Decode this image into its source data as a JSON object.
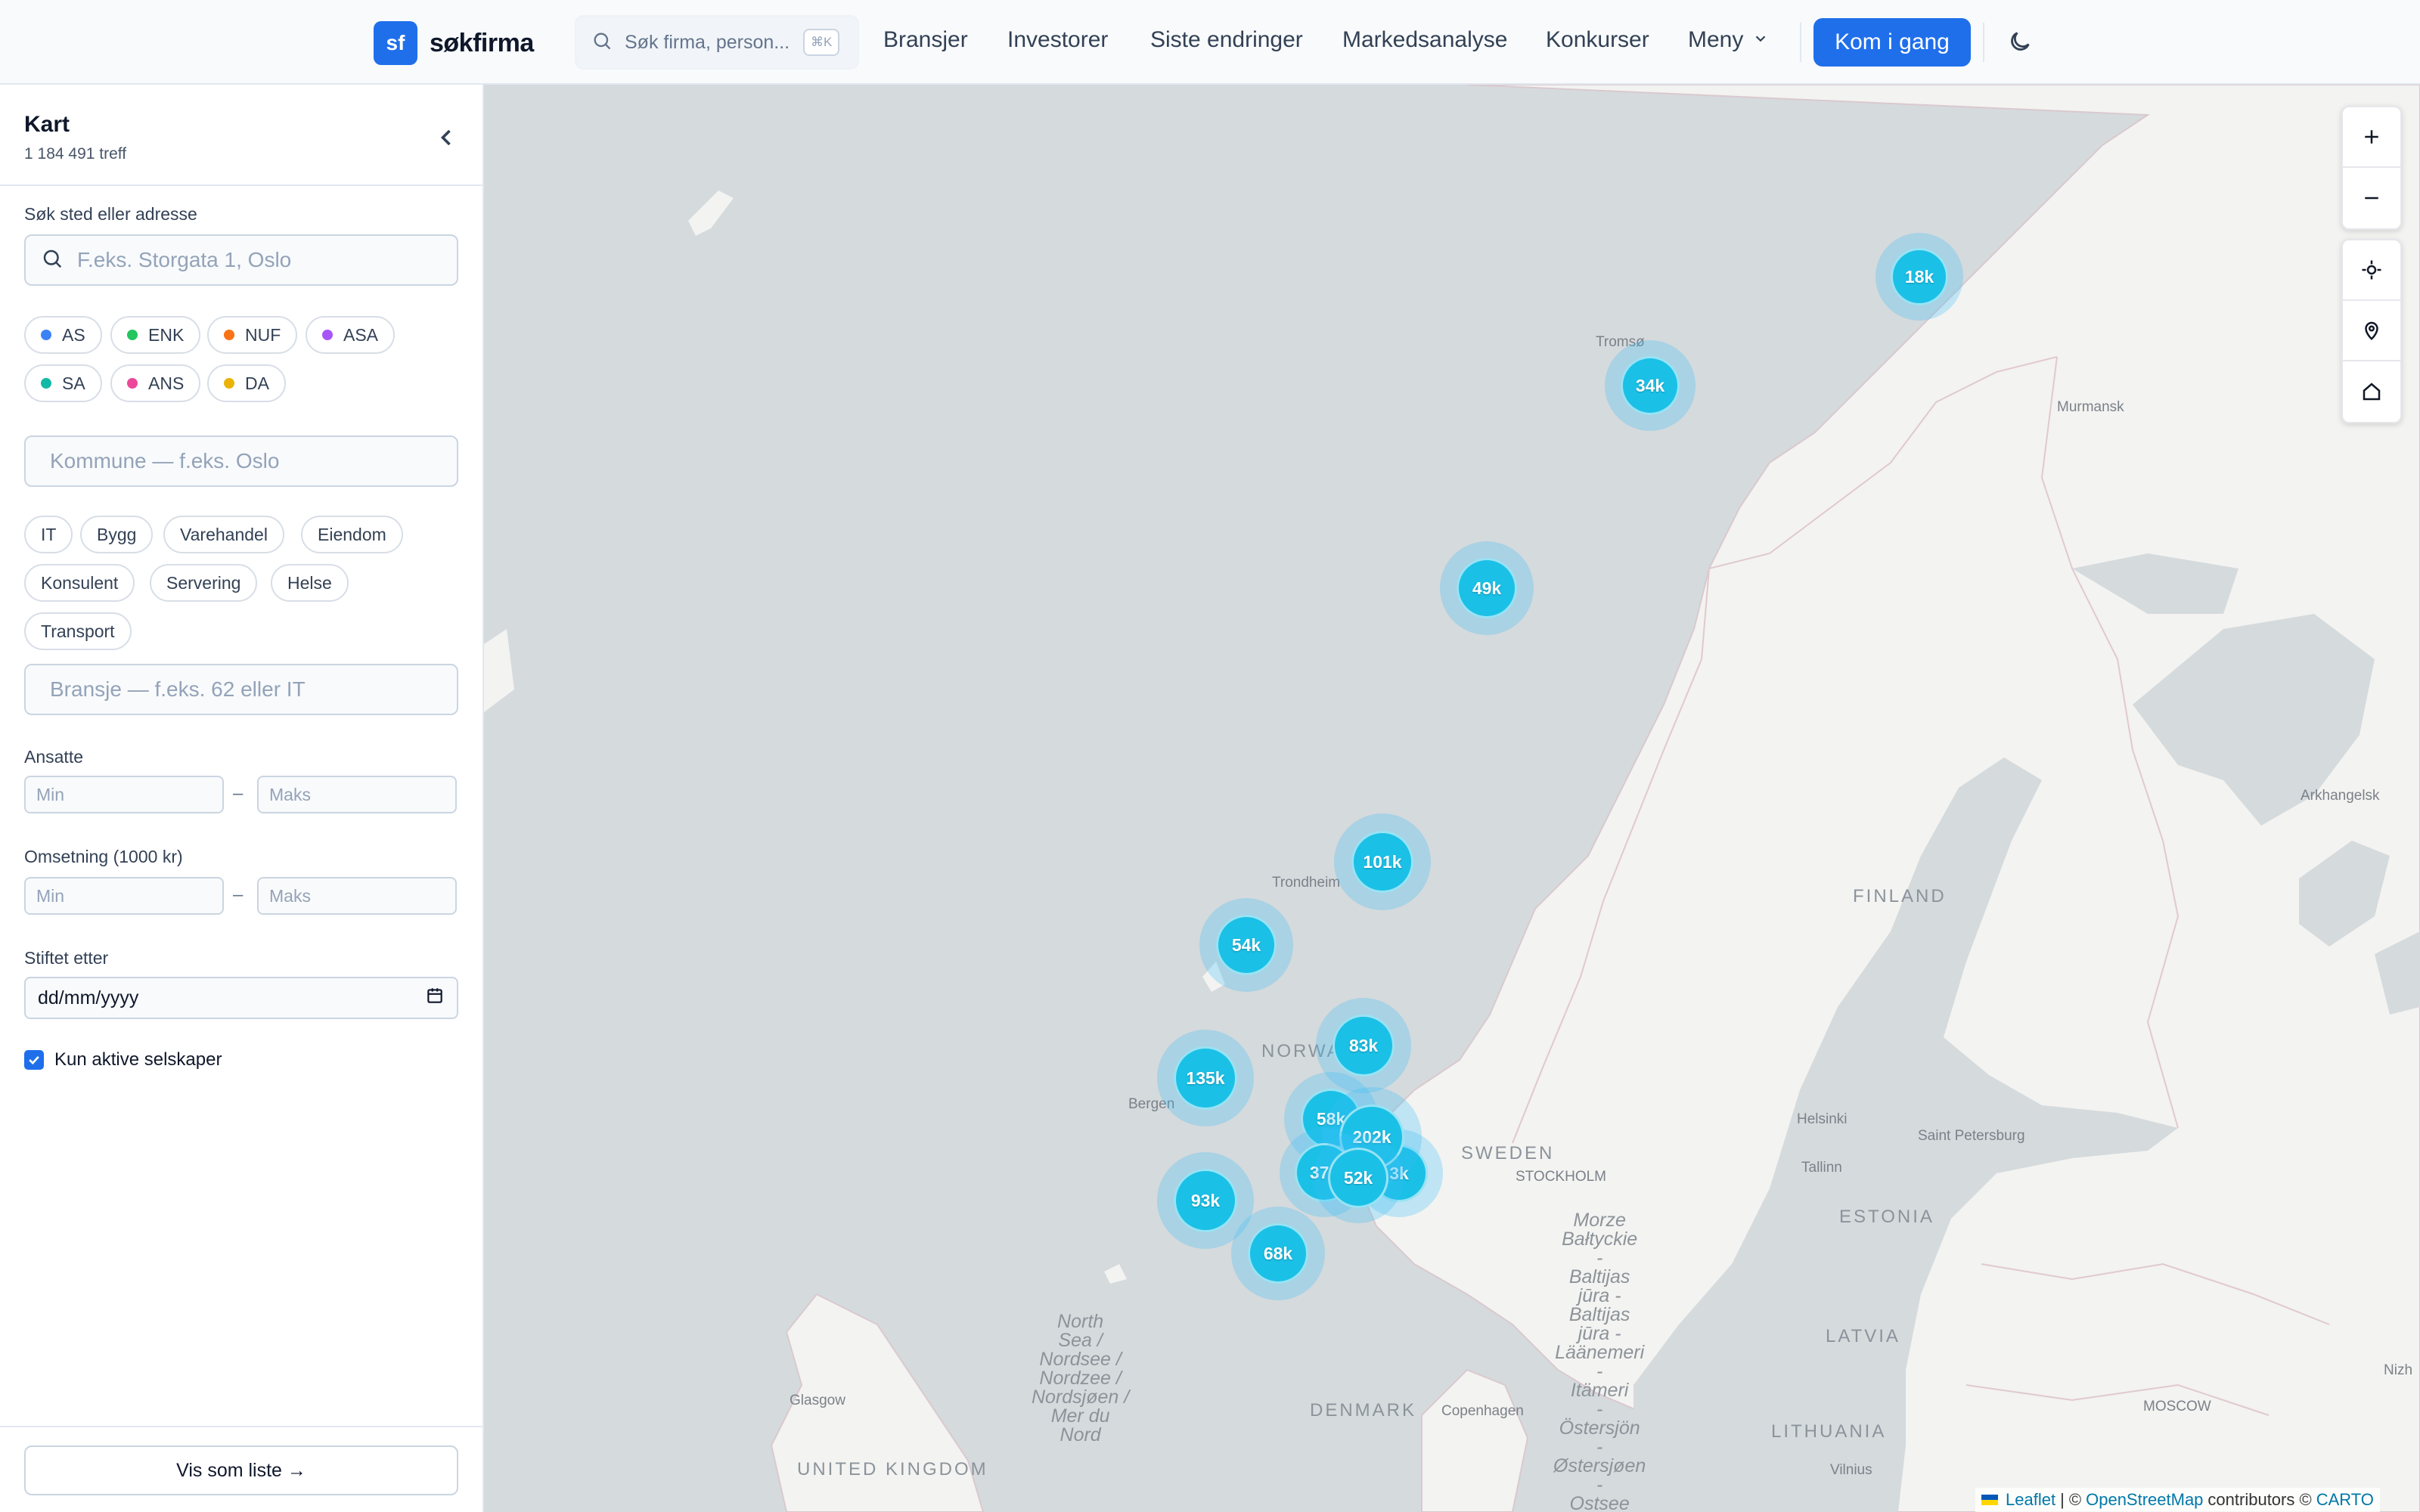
{
  "header": {
    "logo_mark": "sf",
    "logo_text": "søkfirma",
    "search_placeholder": "Søk firma, person...",
    "search_shortcut": "⌘K",
    "nav": [
      {
        "label": "Bransjer"
      },
      {
        "label": "Investorer"
      },
      {
        "label": "Siste endringer"
      },
      {
        "label": "Markedsanalyse"
      },
      {
        "label": "Konkurser"
      },
      {
        "label": "Meny"
      }
    ],
    "cta_label": "Kom i gang"
  },
  "sidebar": {
    "title": "Kart",
    "count": "1 184 491 treff",
    "place_label": "Søk sted eller adresse",
    "place_placeholder": "F.eks. Storgata 1, Oslo",
    "company_types": [
      {
        "label": "AS",
        "color": "#3b82f6"
      },
      {
        "label": "ENK",
        "color": "#22c55e"
      },
      {
        "label": "NUF",
        "color": "#f97316"
      },
      {
        "label": "ASA",
        "color": "#a855f7"
      },
      {
        "label": "SA",
        "color": "#14b8a6"
      },
      {
        "label": "ANS",
        "color": "#ec4899"
      },
      {
        "label": "DA",
        "color": "#eab308"
      }
    ],
    "municipality_placeholder": "Kommune — f.eks. Oslo",
    "industries": [
      {
        "label": "IT"
      },
      {
        "label": "Bygg"
      },
      {
        "label": "Varehandel"
      },
      {
        "label": "Eiendom"
      },
      {
        "label": "Konsulent"
      },
      {
        "label": "Servering"
      },
      {
        "label": "Helse"
      },
      {
        "label": "Transport"
      }
    ],
    "industry_placeholder": "Bransje — f.eks. 62 eller IT",
    "employees_label": "Ansatte",
    "revenue_label": "Omsetning (1000 kr)",
    "min_placeholder": "Min",
    "max_placeholder": "Maks",
    "range_separator": "–",
    "founded_label": "Stiftet etter",
    "founded_placeholder": "dd/mm/yyyy",
    "active_only_label": "Kun aktive selskaper",
    "active_only_checked": true,
    "list_button": "Vis som liste →"
  },
  "map": {
    "clusters": [
      {
        "label": "18k"
      },
      {
        "label": "34k"
      },
      {
        "label": "49k"
      },
      {
        "label": "101k"
      },
      {
        "label": "54k"
      },
      {
        "label": "83k"
      },
      {
        "label": "135k"
      },
      {
        "label": "58k"
      },
      {
        "label": "202k"
      },
      {
        "label": "3k"
      },
      {
        "label": "37k"
      },
      {
        "label": "52k"
      },
      {
        "label": "93k"
      },
      {
        "label": "68k"
      }
    ],
    "places": [
      {
        "label": "Tromsø"
      },
      {
        "label": "Murmansk"
      },
      {
        "label": "Trondheim"
      },
      {
        "label": "Bergen"
      },
      {
        "label": "STOCKHOLM"
      },
      {
        "label": "Helsinki"
      },
      {
        "label": "Tallinn"
      },
      {
        "label": "Saint Petersburg"
      },
      {
        "label": "Arkhangelsk"
      },
      {
        "label": "Copenhagen"
      },
      {
        "label": "Glasgow"
      },
      {
        "label": "Vilnius"
      },
      {
        "label": "MOSCOW"
      },
      {
        "label": "Nizh"
      }
    ],
    "countries": [
      {
        "label": "FINLAND"
      },
      {
        "label": "NORWA"
      },
      {
        "label": "SWEDEN"
      },
      {
        "label": "ESTONIA"
      },
      {
        "label": "LATVIA"
      },
      {
        "label": "LITHUANIA"
      },
      {
        "label": "DENMARK"
      },
      {
        "label": "UNITED KINGDOM"
      }
    ],
    "seas": [
      {
        "label": "North\nSea /\nNordsee /\nNordzee /\nNordsjøen /\nMer du\nNord"
      },
      {
        "label": "Morze\nBałtyckie\n-\nBaltijas\njūra -\nBaltijas\njūra -\nLäänemeri\n-\nItämeri\n-\nÖstersjön\n-\nØstersjøen\n-\nOstsee"
      }
    ],
    "attribution": {
      "leaflet": "Leaflet",
      "sep1": "| ©",
      "osm": "OpenStreetMap",
      "contributors": "contributors ©",
      "carto": "CARTO"
    }
  }
}
